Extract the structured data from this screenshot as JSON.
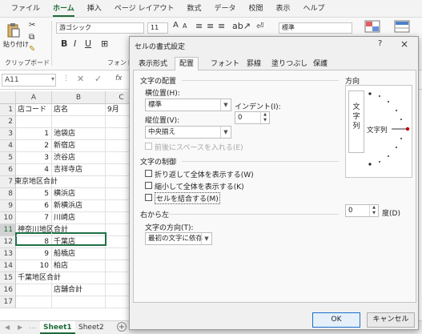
{
  "menu": [
    "ファイル",
    "ホーム",
    "挿入",
    "ページ レイアウト",
    "数式",
    "データ",
    "校閲",
    "表示",
    "ヘルプ"
  ],
  "ribbon": {
    "paste_label": "貼り付け",
    "clipboard_label": "クリップボード",
    "font_group_label": "フォント",
    "font_name": "游ゴシック",
    "font_size": "11",
    "number_format": "標準",
    "bold": "B",
    "italic": "I",
    "underline": "U"
  },
  "formula_bar": {
    "name_box": "A11",
    "fx": "fx"
  },
  "grid": {
    "columns": [
      "A",
      "B",
      "C"
    ],
    "rows": [
      {
        "num": "1",
        "a": "店コード",
        "b": "店名",
        "c": "9月"
      },
      {
        "num": "2",
        "a": "",
        "b": "",
        "c": ""
      },
      {
        "num": "3",
        "a": "1",
        "b": "池袋店",
        "c": ""
      },
      {
        "num": "4",
        "a": "2",
        "b": "新宿店",
        "c": ""
      },
      {
        "num": "5",
        "a": "3",
        "b": "渋谷店",
        "c": ""
      },
      {
        "num": "6",
        "a": "4",
        "b": "吉祥寺店",
        "c": ""
      },
      {
        "num": "7",
        "a": "東京地区合計",
        "b": "",
        "c": ""
      },
      {
        "num": "8",
        "a": "5",
        "b": "横浜店",
        "c": ""
      },
      {
        "num": "9",
        "a": "6",
        "b": "新横浜店",
        "c": ""
      },
      {
        "num": "10",
        "a": "7",
        "b": "川崎店",
        "c": ""
      },
      {
        "num": "11",
        "a": "神奈川地区合計",
        "b": "",
        "c": ""
      },
      {
        "num": "12",
        "a": "8",
        "b": "千葉店",
        "c": ""
      },
      {
        "num": "13",
        "a": "9",
        "b": "船橋店",
        "c": ""
      },
      {
        "num": "14",
        "a": "10",
        "b": "柏店",
        "c": ""
      },
      {
        "num": "15",
        "a": "千葉地区合計",
        "b": "",
        "c": ""
      },
      {
        "num": "16",
        "a": "",
        "b": "店舗合計",
        "c": ""
      },
      {
        "num": "17",
        "a": "",
        "b": "",
        "c": ""
      }
    ]
  },
  "sheets": [
    "Sheet1",
    "Sheet2"
  ],
  "dialog": {
    "title": "セルの書式設定",
    "help": "?",
    "close": "×",
    "tabs": [
      "表示形式",
      "配置",
      "フォント",
      "罫線",
      "塗りつぶし",
      "保護"
    ],
    "active_tab": "配置",
    "alignment_section": "文字の配置",
    "horizontal_label": "横位置(H):",
    "horizontal_value": "標準",
    "indent_label": "インデント(I):",
    "indent_value": "0",
    "vertical_label": "縦位置(V):",
    "vertical_value": "中央揃え",
    "distributed_label": "前後にスペースを入れる(E)",
    "control_section": "文字の制御",
    "wrap_label": "折り返して全体を表示する(W)",
    "shrink_label": "縮小して全体を表示する(K)",
    "merge_label": "セルを結合する(M)",
    "rtl_section": "右から左",
    "direction_label": "文字の方向(T):",
    "direction_value": "最初の文字に依存",
    "orientation_section": "方向",
    "vertical_text": "文字列",
    "horizontal_text": "文字列",
    "degree_value": "0",
    "degree_label": "度(D)",
    "ok": "OK",
    "cancel": "キャンセル"
  }
}
